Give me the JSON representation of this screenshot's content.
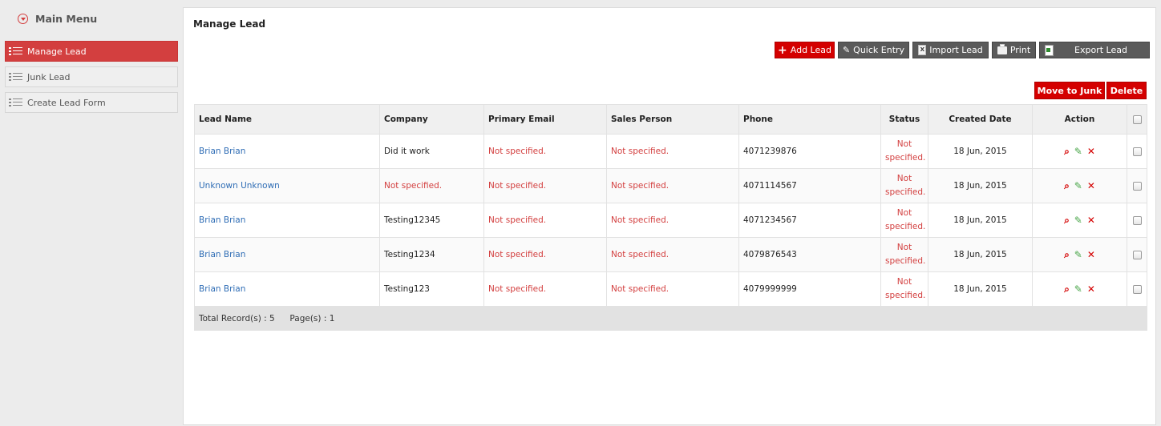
{
  "sidebar": {
    "title": "Main Menu",
    "items": [
      {
        "label": "Manage Lead",
        "active": true
      },
      {
        "label": "Junk Lead",
        "active": false
      },
      {
        "label": "Create Lead Form",
        "active": false
      }
    ]
  },
  "page": {
    "title": "Manage Lead"
  },
  "toolbar": {
    "add_lead": "Add Lead",
    "quick_entry": "Quick Entry",
    "import_lead": "Import Lead",
    "print": "Print",
    "export_lead": "Export Lead",
    "move_to_junk": "Move to Junk",
    "delete": "Delete"
  },
  "table": {
    "columns": [
      "Lead Name",
      "Company",
      "Primary Email",
      "Sales Person",
      "Phone",
      "Status",
      "Created Date",
      "Action"
    ],
    "rows": [
      {
        "lead_name": "Brian Brian",
        "company": "Did it work",
        "email": "Not specified.",
        "sales_person": "Not specified.",
        "phone": "4071239876",
        "status": "Not specified.",
        "created": "18 Jun, 2015"
      },
      {
        "lead_name": "Unknown Unknown",
        "company": "Not specified.",
        "email": "Not specified.",
        "sales_person": "Not specified.",
        "phone": "4071114567",
        "status": "Not specified.",
        "created": "18 Jun, 2015"
      },
      {
        "lead_name": "Brian Brian",
        "company": "Testing12345",
        "email": "Not specified.",
        "sales_person": "Not specified.",
        "phone": "4071234567",
        "status": "Not specified.",
        "created": "18 Jun, 2015"
      },
      {
        "lead_name": "Brian Brian",
        "company": "Testing1234",
        "email": "Not specified.",
        "sales_person": "Not specified.",
        "phone": "4079876543",
        "status": "Not specified.",
        "created": "18 Jun, 2015"
      },
      {
        "lead_name": "Brian Brian",
        "company": "Testing123",
        "email": "Not specified.",
        "sales_person": "Not specified.",
        "phone": "4079999999",
        "status": "Not specified.",
        "created": "18 Jun, 2015"
      }
    ],
    "footer": {
      "total_label": "Total Record(s) :",
      "total_value": "5",
      "pages_label": "Page(s) :",
      "pages_value": "1"
    }
  },
  "icons": {
    "menu_toggle": "circle-chevron-down-icon",
    "list": "list-icon",
    "add": "plus-icon",
    "quick_entry": "pencil-icon",
    "import": "document-icon",
    "print": "printer-icon",
    "export": "spreadsheet-icon",
    "view": "magnifier-icon",
    "edit": "pencil-icon",
    "delete": "close-icon"
  },
  "colors": {
    "accent_red": "#d40000",
    "sidebar_active": "#d33f3f",
    "link_blue": "#2f6db5",
    "button_dark": "#555555"
  }
}
